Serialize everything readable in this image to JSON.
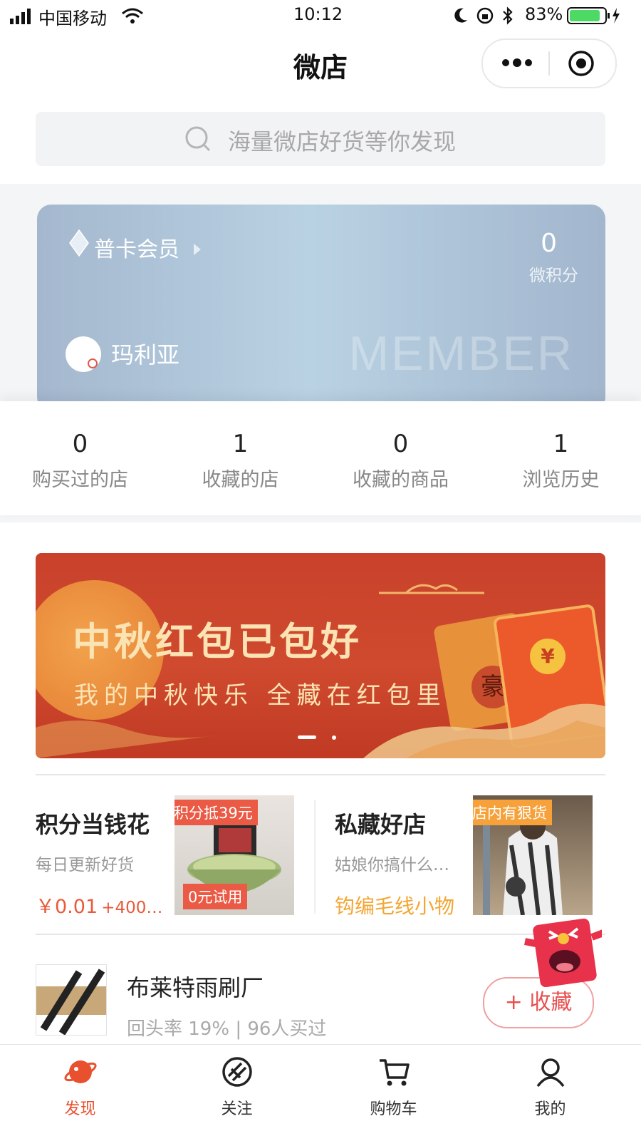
{
  "status_bar": {
    "carrier": "中国移动",
    "time": "10:12",
    "battery": "83%"
  },
  "nav": {
    "title": "微店"
  },
  "search": {
    "placeholder": "海量微店好货等你发现"
  },
  "member_card": {
    "level": "普卡会员",
    "points_value": "0",
    "points_label": "微积分",
    "user_name": "玛利亚",
    "watermark": "MEMBER"
  },
  "stats": [
    {
      "value": "0",
      "label": "购买过的店"
    },
    {
      "value": "1",
      "label": "收藏的店"
    },
    {
      "value": "0",
      "label": "收藏的商品"
    },
    {
      "value": "1",
      "label": "浏览历史"
    }
  ],
  "banner": {
    "title": "中秋红包已包好",
    "subtitle": "我的中秋快乐 全藏在红包里",
    "coin_symbol": "¥",
    "envelope_char": "豪",
    "slide_count": 2,
    "active_slide": 1
  },
  "promos": [
    {
      "title": "积分当钱花",
      "subtitle": "每日更新好货",
      "price": "￥0.01",
      "extra": "+400…",
      "tag": "积分抵39元",
      "tag2": "0元试用"
    },
    {
      "title": "私藏好店",
      "subtitle": "姑娘你搞什么…",
      "highlight": "钩编毛线小物",
      "tag": "店内有狠货"
    }
  ],
  "store": {
    "name": "布莱特雨刷厂",
    "meta": "回头率 19% | 96人买过",
    "collect_label": "+ 收藏"
  },
  "tabs": [
    {
      "label": "发现",
      "icon": "planet-icon",
      "active": true
    },
    {
      "label": "关注",
      "icon": "follow-icon",
      "active": false
    },
    {
      "label": "购物车",
      "icon": "cart-icon",
      "active": false
    },
    {
      "label": "我的",
      "icon": "profile-icon",
      "active": false
    }
  ],
  "colors": {
    "accent": "#e8502e",
    "price": "#e85a3a",
    "gold": "#f3a634",
    "banner_red": "#c9412b"
  }
}
